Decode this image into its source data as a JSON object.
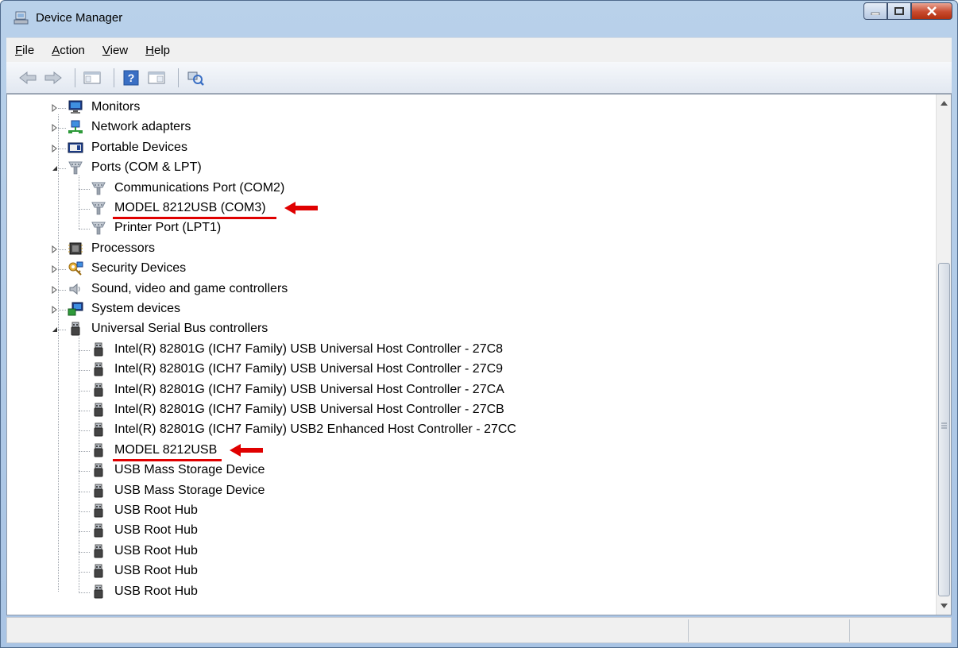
{
  "window": {
    "title": "Device Manager"
  },
  "menu": {
    "items": [
      {
        "underline": "F",
        "rest": "ile"
      },
      {
        "underline": "A",
        "rest": "ction"
      },
      {
        "underline": "V",
        "rest": "iew"
      },
      {
        "underline": "H",
        "rest": "elp"
      }
    ]
  },
  "toolbar": {
    "buttons": [
      "back-arrow-icon",
      "forward-arrow-icon",
      "show-hide-console-tree-icon",
      "help-icon",
      "properties-icon",
      "scan-hardware-icon"
    ]
  },
  "tree": {
    "monitors": "Monitors",
    "network_adapters": "Network adapters",
    "portable_devices": "Portable Devices",
    "ports": "Ports (COM & LPT)",
    "ports_children": [
      "Communications Port (COM2)",
      "MODEL 8212USB (COM3)",
      "Printer Port (LPT1)"
    ],
    "processors": "Processors",
    "security_devices": "Security Devices",
    "sound": "Sound, video and game controllers",
    "system_devices": "System devices",
    "usb": "Universal Serial Bus controllers",
    "usb_children": [
      "Intel(R) 82801G (ICH7 Family) USB Universal Host Controller - 27C8",
      "Intel(R) 82801G (ICH7 Family) USB Universal Host Controller - 27C9",
      "Intel(R) 82801G (ICH7 Family) USB Universal Host Controller - 27CA",
      "Intel(R) 82801G (ICH7 Family) USB Universal Host Controller - 27CB",
      "Intel(R) 82801G (ICH7 Family) USB2 Enhanced Host Controller - 27CC",
      "MODEL 8212USB",
      "USB Mass Storage Device",
      "USB Mass Storage Device",
      "USB Root Hub",
      "USB Root Hub",
      "USB Root Hub",
      "USB Root Hub",
      "USB Root Hub"
    ]
  },
  "annotations": {
    "color": "#e00000"
  },
  "colors": {
    "accent": "#b9d1ea",
    "close_button": "#c84a2e"
  }
}
